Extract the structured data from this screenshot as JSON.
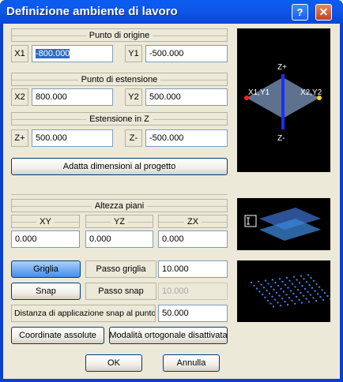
{
  "window": {
    "title": "Definizione ambiente di lavoro",
    "help_glyph": "?",
    "close_glyph": "✕"
  },
  "origin": {
    "header": "Punto di origine",
    "x1_label": "X1",
    "x1_value": "-800.000",
    "y1_label": "Y1",
    "y1_value": "-500.000"
  },
  "extension": {
    "header": "Punto di estensione",
    "x2_label": "X2",
    "x2_value": "800.000",
    "y2_label": "Y2",
    "y2_value": "500.000"
  },
  "z_extension": {
    "header": "Estensione in Z",
    "zplus_label": "Z+",
    "zplus_value": "500.000",
    "zminus_label": "Z-",
    "zminus_value": "-500.000"
  },
  "fit_button": "Adatta dimensioni al progetto",
  "preview_extent": {
    "z_top": "Z+",
    "z_bottom": "Z-",
    "p1": "X1,Y1",
    "p2": "X2,Y2"
  },
  "floor_heights": {
    "header": "Altezza piani",
    "columns": [
      "XY",
      "YZ",
      "ZX"
    ],
    "values": [
      "0.000",
      "0.000",
      "0.000"
    ]
  },
  "grid": {
    "grid_button": "Griglia",
    "grid_step_label": "Passo griglia",
    "grid_step_value": "10.000",
    "snap_button": "Snap",
    "snap_step_label": "Passo snap",
    "snap_step_value": "10.000",
    "snap_distance_label": "Distanza di applicazione snap al punto",
    "snap_distance_value": "50.000"
  },
  "bottom_buttons": {
    "absolute_coords": "Coordinate assolute",
    "ortho_mode": "Modalità ortogonale disattivata"
  },
  "dialog_buttons": {
    "ok": "OK",
    "cancel": "Annulla"
  },
  "colors": {
    "titlebar": "#0a5df0",
    "dialog_bg": "#ece9d8",
    "selection": "#316ac5",
    "z_axis": "#1a2fff",
    "point1": "#ff2020",
    "point2": "#ffd800"
  }
}
